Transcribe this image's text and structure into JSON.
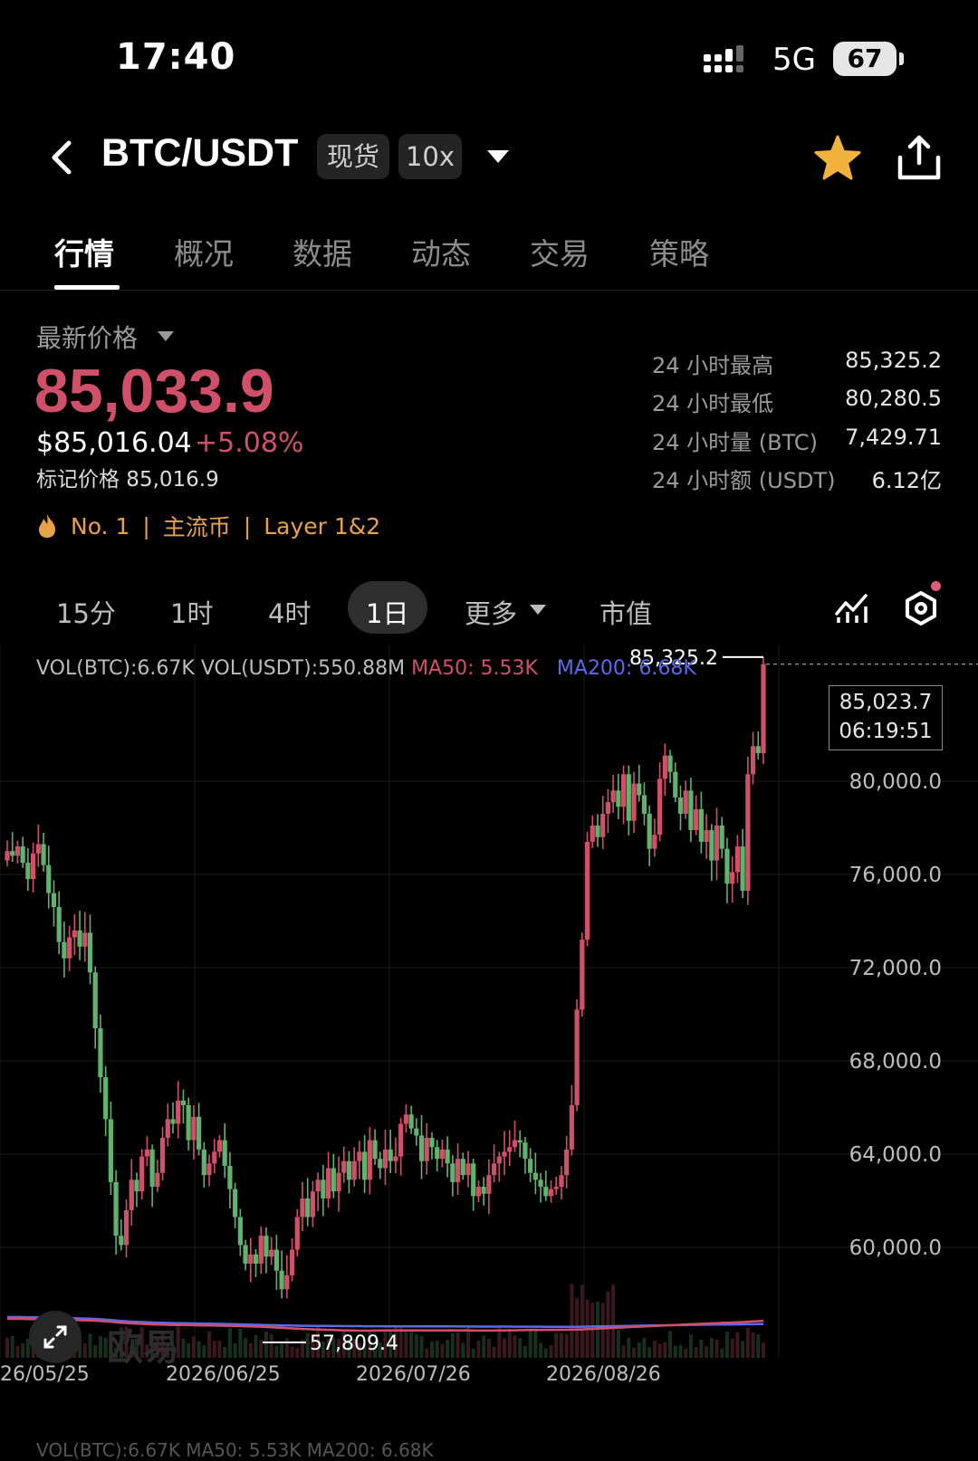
{
  "status_bar": {
    "time": "17:40",
    "network": "5G",
    "battery": "67"
  },
  "header": {
    "pair": "BTC/USDT",
    "market_type": "现货",
    "leverage": "10x"
  },
  "tabs": [
    {
      "label": "行情",
      "active": true
    },
    {
      "label": "概况",
      "active": false
    },
    {
      "label": "数据",
      "active": false
    },
    {
      "label": "动态",
      "active": false
    },
    {
      "label": "交易",
      "active": false
    },
    {
      "label": "策略",
      "active": false
    }
  ],
  "price": {
    "label": "最新价格",
    "last": "85,033.9",
    "usd": "$85,016.04",
    "change": "+5.08%",
    "mark": "标记价格 85,016.9"
  },
  "tags": {
    "rank": "No. 1",
    "category": "主流币",
    "layer": "Layer 1&2",
    "sep": "|"
  },
  "stats": [
    {
      "label": "24 小时最高",
      "value": "85,325.2"
    },
    {
      "label": "24 小时最低",
      "value": "80,280.5"
    },
    {
      "label": "24 小时量 (BTC)",
      "value": "7,429.71"
    },
    {
      "label": "24 小时额 (USDT)",
      "value": "6.12亿"
    }
  ],
  "intervals": {
    "m15": "15分",
    "h1": "1时",
    "h4": "4时",
    "d1": "1日",
    "more": "更多",
    "mcap": "市值"
  },
  "legend": {
    "vol_btc": "VOL(BTC):6.67K",
    "vol_usdt": "VOL(USDT):550.88M",
    "ma50": "MA50: 5.53K",
    "ma200": "MA200: 6.68K"
  },
  "crosshair": {
    "price": "85,023.7",
    "time": "06:19:51"
  },
  "watermark": "欧易",
  "bottom_text": "VOL(BTC):6.67K  MA50: 5.53K  MA200: 6.68K",
  "colors": {
    "up": "#d0506a",
    "down": "#5fb36a",
    "ma50": "#d0506a",
    "ma200": "#5a6ae8"
  },
  "chart_data": {
    "type": "candlestick",
    "yaxis_ticks": [
      {
        "value": 80000,
        "label": "80,000.0"
      },
      {
        "value": 76000,
        "label": "76,000.0"
      },
      {
        "value": 72000,
        "label": "72,000.0"
      },
      {
        "value": 68000,
        "label": "68,000.0"
      },
      {
        "value": 64000,
        "label": "64,000.0"
      },
      {
        "value": 60000,
        "label": "60,000.0"
      }
    ],
    "xaxis_ticks": [
      "26/05/25",
      "2026/06/25",
      "2026/07/26",
      "2026/08/26"
    ],
    "high_label": "85,325.2",
    "low_label": "57,809.4",
    "high": 85325.2,
    "low": 57809.4,
    "close_trajectory": [
      77000,
      76800,
      77200,
      76500,
      75800,
      76900,
      77300,
      76400,
      75200,
      74600,
      73100,
      72400,
      73300,
      73600,
      72900,
      73500,
      71800,
      69400,
      67300,
      65500,
      62800,
      60500,
      60100,
      61600,
      62900,
      62400,
      63900,
      64200,
      62600,
      63200,
      64700,
      65500,
      65300,
      66300,
      66100,
      64600,
      65600,
      64200,
      63100,
      63600,
      64100,
      64600,
      63500,
      62500,
      61300,
      60100,
      59300,
      59700,
      59300,
      60500,
      59600,
      59900,
      59000,
      58200,
      58800,
      59900,
      61300,
      62100,
      61300,
      62400,
      62900,
      62100,
      63400,
      62400,
      63200,
      63700,
      62900,
      63700,
      64100,
      62900,
      64600,
      63800,
      63400,
      64200,
      63700,
      63900,
      65300,
      65700,
      65100,
      64800,
      63700,
      64700,
      64300,
      63800,
      64200,
      63600,
      62800,
      63800,
      63100,
      63600,
      62200,
      62600,
      62300,
      63100,
      63600,
      63900,
      64100,
      64300,
      64600,
      64500,
      63800,
      63200,
      62900,
      62600,
      62200,
      62500,
      62600,
      63100,
      64200,
      66100,
      70200,
      73200,
      77400,
      78100,
      77600,
      78600,
      79100,
      79600,
      78900,
      80300,
      78300,
      79900,
      79400,
      78600,
      77100,
      77700,
      80100,
      81100,
      80400,
      79300,
      78600,
      79600,
      77900,
      78800,
      77400,
      77900,
      76600,
      78100,
      77100,
      75600,
      76100,
      77200,
      75300,
      80300,
      81500,
      81200,
      85023.7
    ]
  }
}
